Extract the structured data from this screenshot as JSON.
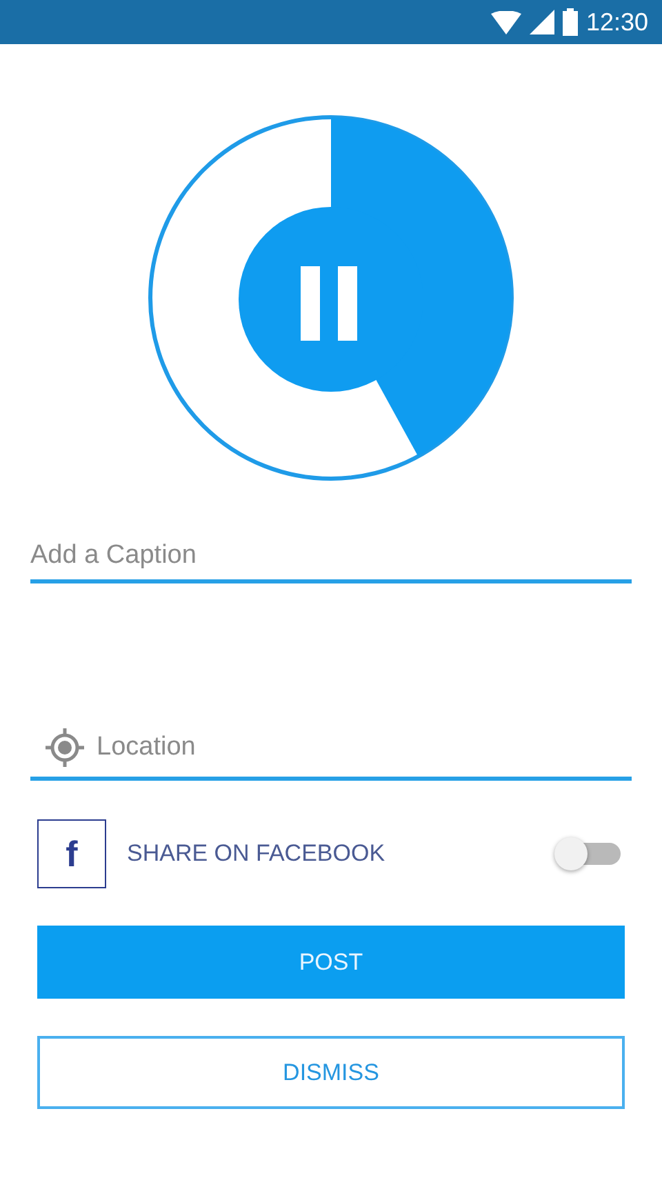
{
  "status_bar": {
    "time": "12:30"
  },
  "recorder": {
    "paused": true
  },
  "caption": {
    "placeholder": "Add a Caption"
  },
  "location": {
    "placeholder": "Location"
  },
  "share": {
    "logo": "f",
    "label": "SHARE ON FACEBOOK",
    "on": false
  },
  "buttons": [
    {
      "label": "POST",
      "kind": "primary"
    },
    {
      "label": "DISMISS",
      "kind": "outline"
    }
  ]
}
